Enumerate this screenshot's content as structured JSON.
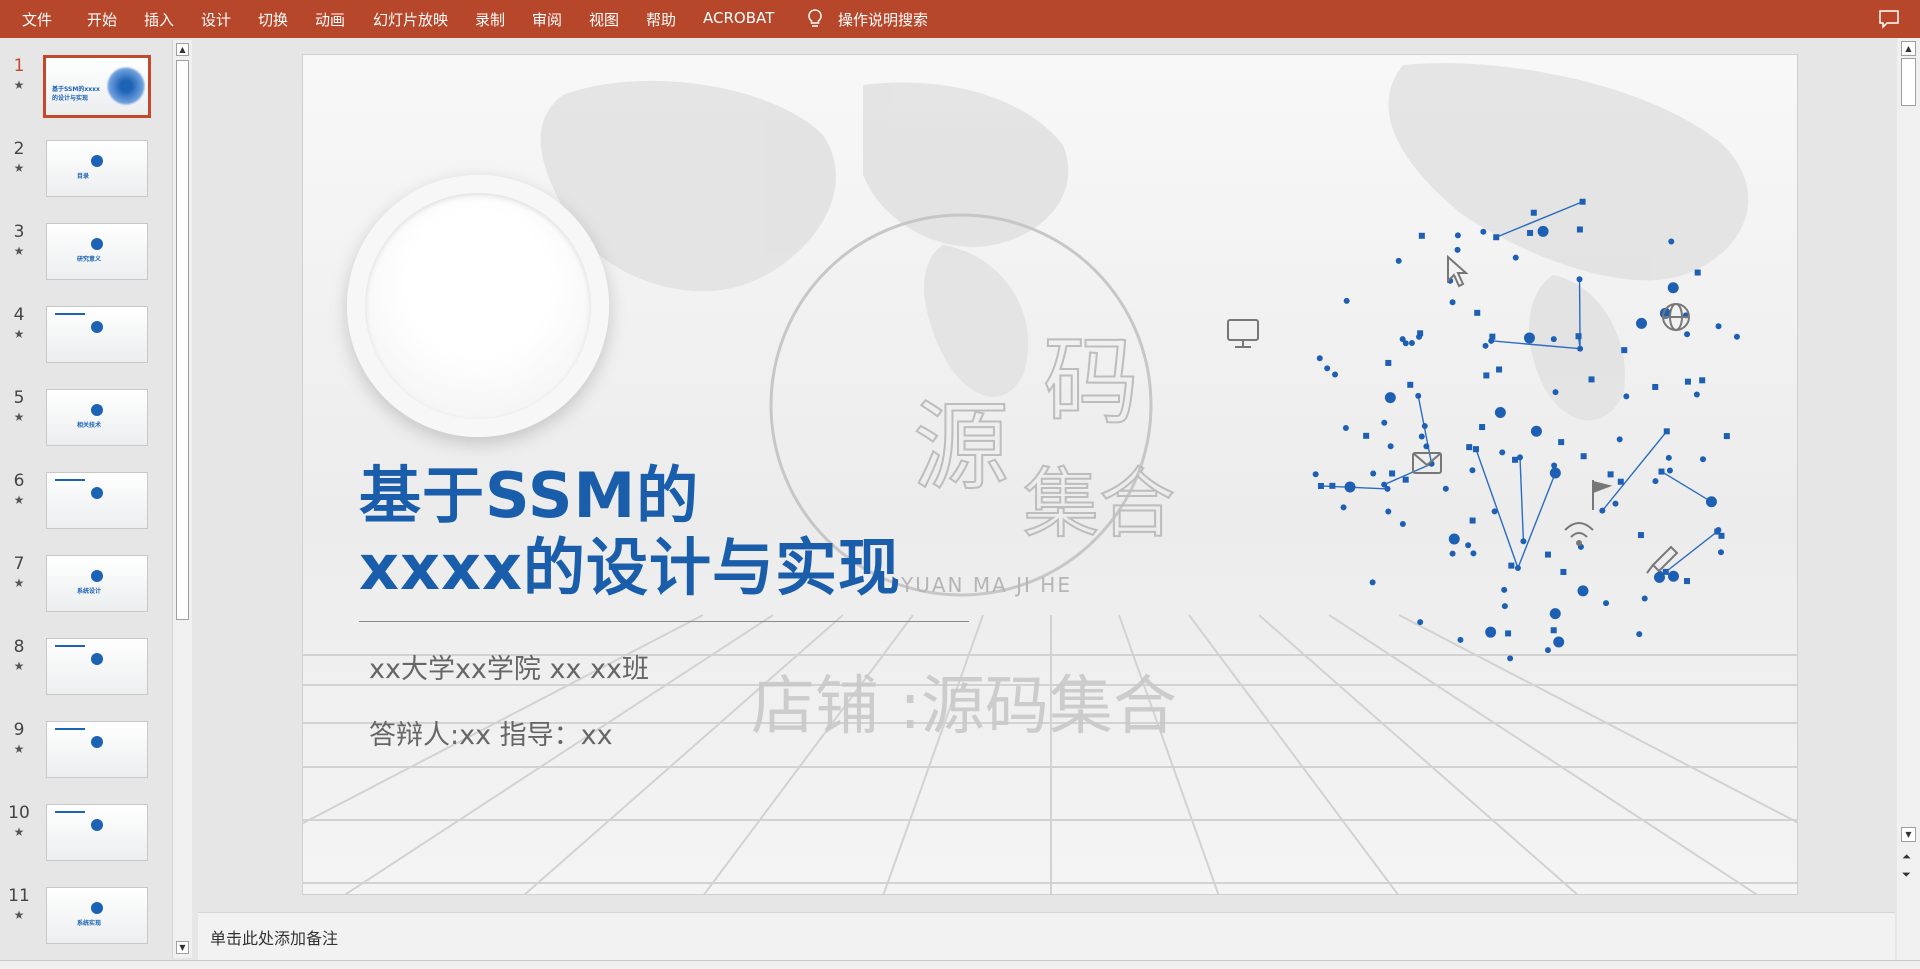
{
  "menu": {
    "items": [
      "文件",
      "开始",
      "插入",
      "设计",
      "切换",
      "动画",
      "幻灯片放映",
      "录制",
      "审阅",
      "视图",
      "帮助",
      "ACROBAT"
    ],
    "search_label": "操作说明搜索"
  },
  "thumbnails": [
    {
      "num": "1",
      "title": "基于SSM的xxxx的设计与实现",
      "selected": true
    },
    {
      "num": "2",
      "title": "目录"
    },
    {
      "num": "3",
      "title": "研究意义"
    },
    {
      "num": "4",
      "title": ""
    },
    {
      "num": "5",
      "title": "相关技术"
    },
    {
      "num": "6",
      "title": ""
    },
    {
      "num": "7",
      "title": "系统设计"
    },
    {
      "num": "8",
      "title": ""
    },
    {
      "num": "9",
      "title": ""
    },
    {
      "num": "10",
      "title": ""
    },
    {
      "num": "11",
      "title": "系统实现"
    }
  ],
  "slide": {
    "title_line1": "基于SSM的",
    "title_line2": "xxxx的设计与实现",
    "subtitle1": "xx大学xx学院 xx xx班",
    "subtitle2": "答辩人:xx 指导：xx",
    "watermark_store": "店铺 :源码集合",
    "watermark_pinyin": "YUAN MA JI HE",
    "accent_color": "#1a5eab"
  },
  "notes": {
    "placeholder": "单击此处添加备注"
  },
  "icons": {
    "lightbulb": "lightbulb-icon",
    "comment": "comment-icon",
    "monitor": "monitor-icon",
    "globe": "globe-icon",
    "mail": "mail-icon",
    "wifi": "wifi-icon",
    "pen": "pen-icon",
    "flag": "flag-icon",
    "cursor": "cursor-icon"
  }
}
